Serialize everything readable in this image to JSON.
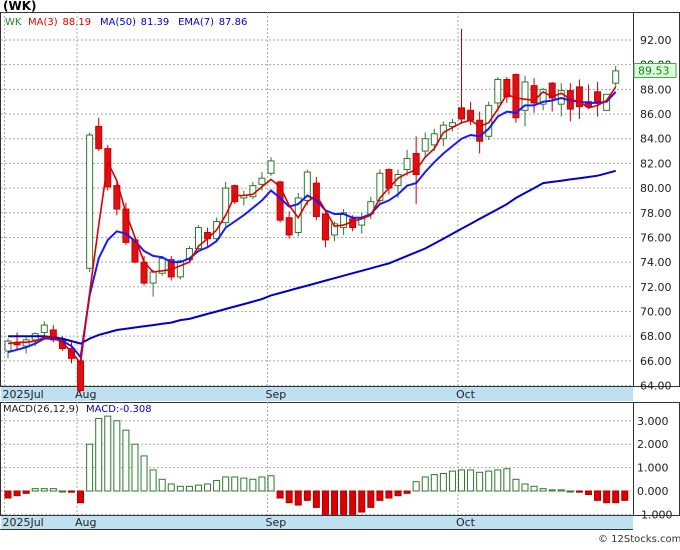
{
  "chart_data": [
    {
      "type": "candlestick",
      "title": "(WK)",
      "indicators_label": "WK",
      "legend": [
        {
          "label": "MA(3)",
          "value": "88.19",
          "color": "#dd0000"
        },
        {
          "label": "MA(50)",
          "value": "81.39",
          "color": "#0000cc"
        },
        {
          "label": "EMA(7)",
          "value": "87.86",
          "color": "#0000cc"
        }
      ],
      "last_price": "89.53",
      "price_ticks": [
        "92.00",
        "90.00",
        "88.00",
        "86.00",
        "84.00",
        "82.00",
        "80.00",
        "78.00",
        "76.00",
        "74.00",
        "72.00",
        "70.00",
        "68.00",
        "66.00",
        "64.00"
      ],
      "price_tick_values": [
        92,
        90,
        88,
        86,
        84,
        82,
        80,
        78,
        76,
        74,
        72,
        70,
        68,
        66,
        64
      ],
      "x_labels": [
        {
          "label": "2025Jul",
          "bar": 0
        },
        {
          "label": "Aug",
          "bar": 8
        },
        {
          "label": "Sep",
          "bar": 29
        },
        {
          "label": "Oct",
          "bar": 50
        }
      ],
      "candles": [
        [
          66.8,
          67.8,
          66.2,
          67.6
        ],
        [
          67.5,
          68.3,
          66.9,
          67.3
        ],
        [
          67.2,
          67.9,
          66.6,
          67.7
        ],
        [
          67.7,
          68.3,
          67.2,
          68.2
        ],
        [
          68.3,
          69.2,
          67.8,
          68.9
        ],
        [
          68.5,
          68.9,
          67.5,
          67.7
        ],
        [
          67.7,
          68.0,
          66.8,
          67.0
        ],
        [
          67.0,
          67.5,
          65.8,
          66.2
        ],
        [
          66.0,
          66.2,
          63.5,
          63.6
        ],
        [
          73.5,
          84.5,
          73.2,
          84.3
        ],
        [
          85.0,
          85.7,
          83.0,
          83.2
        ],
        [
          83.2,
          83.5,
          79.8,
          80.1
        ],
        [
          80.2,
          80.5,
          77.8,
          78.3
        ],
        [
          78.3,
          78.8,
          75.4,
          75.6
        ],
        [
          75.8,
          75.9,
          73.9,
          74.0
        ],
        [
          74.0,
          74.5,
          72.1,
          72.3
        ],
        [
          72.3,
          73.4,
          71.2,
          73.2
        ],
        [
          73.1,
          74.5,
          72.9,
          74.3
        ],
        [
          74.2,
          74.5,
          72.5,
          72.8
        ],
        [
          72.8,
          74.2,
          72.6,
          74.1
        ],
        [
          74.2,
          75.3,
          73.9,
          75.1
        ],
        [
          75.1,
          77.0,
          75.0,
          76.8
        ],
        [
          76.4,
          76.8,
          75.3,
          75.9
        ],
        [
          75.9,
          77.6,
          75.7,
          77.3
        ],
        [
          77.2,
          80.5,
          76.9,
          80.0
        ],
        [
          80.2,
          80.3,
          78.7,
          78.9
        ],
        [
          79.2,
          79.8,
          78.6,
          79.4
        ],
        [
          79.3,
          80.5,
          79.1,
          80.2
        ],
        [
          80.3,
          81.3,
          79.8,
          80.8
        ],
        [
          81.2,
          82.5,
          81.0,
          82.2
        ],
        [
          80.5,
          80.6,
          77.2,
          77.4
        ],
        [
          77.6,
          78.1,
          75.9,
          76.2
        ],
        [
          76.4,
          79.6,
          76.1,
          79.2
        ],
        [
          79.0,
          81.5,
          78.6,
          81.3
        ],
        [
          80.4,
          80.9,
          77.4,
          77.7
        ],
        [
          77.9,
          78.2,
          75.2,
          75.8
        ],
        [
          76.2,
          77.3,
          75.7,
          77.1
        ],
        [
          76.8,
          78.3,
          76.2,
          78.0
        ],
        [
          77.5,
          77.8,
          76.5,
          76.8
        ],
        [
          77.0,
          78.0,
          76.3,
          77.6
        ],
        [
          77.9,
          79.3,
          77.5,
          78.9
        ],
        [
          79.0,
          81.5,
          78.8,
          81.2
        ],
        [
          81.5,
          81.6,
          79.5,
          80.0
        ],
        [
          80.2,
          81.5,
          79.2,
          81.1
        ],
        [
          81.5,
          83.1,
          81.0,
          82.4
        ],
        [
          82.8,
          84.2,
          78.7,
          81.1
        ],
        [
          83.0,
          84.5,
          82.5,
          84.0
        ],
        [
          83.5,
          84.8,
          83.0,
          84.4
        ],
        [
          84.0,
          85.4,
          83.4,
          85.1
        ],
        [
          85.0,
          85.6,
          84.6,
          85.3
        ],
        [
          86.5,
          92.9,
          85.2,
          85.6
        ],
        [
          86.3,
          87.0,
          85.1,
          85.5
        ],
        [
          85.5,
          86.2,
          82.8,
          83.8
        ],
        [
          84.2,
          87.0,
          83.9,
          86.7
        ],
        [
          86.9,
          89.0,
          86.2,
          88.8
        ],
        [
          88.8,
          89.0,
          86.9,
          87.4
        ],
        [
          89.2,
          89.3,
          85.3,
          85.7
        ],
        [
          86.3,
          89.1,
          85.0,
          88.6
        ],
        [
          88.3,
          88.9,
          86.1,
          86.9
        ],
        [
          86.8,
          88.1,
          86.3,
          88.0
        ],
        [
          88.5,
          88.6,
          86.2,
          87.3
        ],
        [
          86.8,
          88.5,
          85.8,
          87.9
        ],
        [
          87.9,
          88.5,
          85.4,
          86.4
        ],
        [
          88.2,
          88.8,
          85.6,
          86.6
        ],
        [
          87.0,
          88.4,
          86.4,
          86.6
        ],
        [
          87.8,
          88.6,
          85.8,
          87.0
        ],
        [
          86.3,
          87.6,
          86.3,
          87.6
        ],
        [
          88.5,
          89.9,
          88.2,
          89.5
        ]
      ],
      "ma3": [
        67.4,
        67.5,
        67.5,
        67.6,
        67.9,
        67.9,
        67.5,
        66.7,
        65.8,
        71.5,
        77.0,
        82.1,
        80.6,
        78.0,
        76.0,
        74.0,
        73.2,
        73.3,
        73.4,
        73.7,
        74.0,
        75.3,
        75.9,
        76.6,
        77.8,
        79.4,
        79.4,
        79.5,
        80.1,
        80.7,
        80.1,
        78.6,
        77.6,
        78.9,
        79.4,
        78.2,
        76.9,
        77.0,
        77.3,
        77.5,
        77.8,
        79.2,
        80.0,
        80.8,
        81.2,
        81.5,
        82.5,
        83.2,
        84.5,
        84.9,
        85.3,
        85.5,
        85.0,
        85.3,
        86.4,
        87.6,
        87.3,
        87.2,
        87.1,
        87.8,
        87.4,
        87.7,
        87.2,
        87.0,
        86.5,
        86.7,
        87.1,
        88.2
      ],
      "ema7": [
        66.7,
        66.9,
        67.1,
        67.4,
        67.8,
        67.8,
        67.6,
        67.2,
        66.3,
        71.3,
        74.3,
        75.8,
        76.5,
        76.3,
        75.7,
        74.9,
        74.5,
        74.4,
        74.0,
        74.0,
        74.3,
        74.9,
        75.2,
        75.7,
        76.8,
        77.3,
        77.8,
        78.4,
        79.0,
        79.8,
        79.2,
        78.5,
        78.7,
        79.4,
        79.0,
        78.2,
        77.9,
        77.9,
        77.6,
        77.6,
        77.9,
        78.7,
        79.0,
        79.5,
        80.2,
        80.4,
        81.3,
        82.1,
        82.8,
        83.4,
        84.0,
        84.3,
        84.2,
        84.8,
        85.8,
        86.2,
        86.1,
        86.7,
        86.7,
        87.0,
        87.1,
        87.3,
        87.1,
        87.0,
        86.9,
        86.9,
        87.0,
        87.8
      ],
      "ma50": [
        68.0,
        68.0,
        68.0,
        68.0,
        68.0,
        67.9,
        67.8,
        67.6,
        67.4,
        67.8,
        68.1,
        68.3,
        68.5,
        68.6,
        68.7,
        68.8,
        68.9,
        69.0,
        69.1,
        69.3,
        69.4,
        69.6,
        69.8,
        70.0,
        70.2,
        70.4,
        70.6,
        70.8,
        71.0,
        71.3,
        71.5,
        71.7,
        71.9,
        72.1,
        72.3,
        72.5,
        72.7,
        72.9,
        73.1,
        73.3,
        73.5,
        73.7,
        73.9,
        74.2,
        74.5,
        74.8,
        75.1,
        75.5,
        75.9,
        76.3,
        76.7,
        77.1,
        77.5,
        77.9,
        78.3,
        78.7,
        79.2,
        79.6,
        80.0,
        80.4,
        80.5,
        80.6,
        80.7,
        80.8,
        80.9,
        81.0,
        81.2,
        81.4
      ],
      "macd": {
        "label": "MACD(26,12,9)",
        "value_label": "MACD:-0.308",
        "ticks": [
          "3.000",
          "2.000",
          "1.000",
          "0.000",
          "-1.000"
        ],
        "tick_values": [
          3,
          2,
          1,
          0,
          -1
        ],
        "bars": [
          -0.3,
          -0.2,
          -0.1,
          0.1,
          0.1,
          0.1,
          0.0,
          -0.05,
          -0.5,
          2.0,
          3.1,
          3.2,
          3.0,
          2.6,
          2.0,
          1.5,
          0.9,
          0.5,
          0.3,
          0.2,
          0.2,
          0.25,
          0.3,
          0.45,
          0.6,
          0.6,
          0.55,
          0.5,
          0.6,
          0.65,
          -0.3,
          -0.5,
          -0.6,
          -0.4,
          -0.7,
          -1.0,
          -1.0,
          -1.0,
          -1.0,
          -0.9,
          -0.7,
          -0.4,
          -0.3,
          -0.2,
          -0.1,
          0.4,
          0.6,
          0.7,
          0.75,
          0.85,
          0.9,
          0.9,
          0.8,
          0.85,
          0.9,
          0.95,
          0.5,
          0.3,
          0.2,
          0.1,
          0.05,
          0.05,
          0.0,
          -0.05,
          -0.15,
          -0.4,
          -0.5,
          -0.5,
          -0.4
        ]
      }
    }
  ],
  "footer": {
    "copyright": "© 12Stocks.com"
  }
}
